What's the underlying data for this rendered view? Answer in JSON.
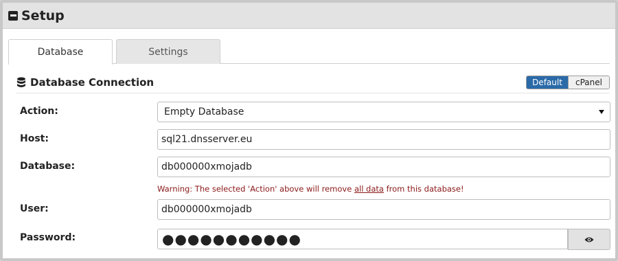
{
  "header": {
    "title": "Setup",
    "icon": "collapse-icon"
  },
  "tabs": [
    {
      "label": "Database",
      "active": true
    },
    {
      "label": "Settings",
      "active": false
    }
  ],
  "section": {
    "title": "Database Connection",
    "icon": "database-icon",
    "toggle": {
      "options": [
        "Default",
        "cPanel"
      ],
      "selected": "Default"
    }
  },
  "form": {
    "action": {
      "label": "Action:",
      "value": "Empty Database"
    },
    "host": {
      "label": "Host:",
      "value": "sql21.dnsserver.eu"
    },
    "database": {
      "label": "Database:",
      "value": "db000000xmojadb"
    },
    "warning": {
      "prefix": "Warning: The selected 'Action' above will remove ",
      "link": "all data",
      "suffix": " from this database!"
    },
    "user": {
      "label": "User:",
      "value": "db000000xmojadb"
    },
    "password": {
      "label": "Password:",
      "value": "●●●●●●●●●●●",
      "reveal_icon": "eye-icon"
    }
  },
  "colors": {
    "accent": "#2a6aa8",
    "warning": "#8a1818",
    "header_bg": "#e3e3e3"
  }
}
